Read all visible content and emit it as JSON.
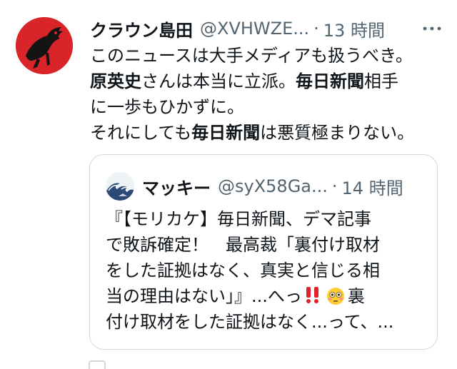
{
  "tweet": {
    "author_name": "クラウン島田",
    "author_handle": "@XVHWZE...",
    "separator": "·",
    "time": "13 時間",
    "lines": {
      "l1": "このニュースは大手メディアも扱うべき。",
      "l2_b1": "原英史",
      "l2_t1": "さんは本当に立派。",
      "l2_b2": "毎日新聞",
      "l2_t2": "相手",
      "l3": "に一歩もひかずに。",
      "l4_t1": "それにしても",
      "l4_b1": "毎日新聞",
      "l4_t2": "は悪質極まりない。"
    }
  },
  "quote": {
    "author_name": "マッキー",
    "author_handle": "@syX58Ga...",
    "separator": "·",
    "time": "14 時間",
    "lines": {
      "l1": "『【モリカケ】毎日新聞、デマ記事",
      "l2": "で敗訴確定！　最高裁「裏付け取材",
      "l3": "をした証拠はなく、真実と信じる相",
      "l4_a": "当の理由はない」』...へっ",
      "l4_b": "裏",
      "l5": "付け取材をした証拠はなく...って、..."
    }
  },
  "icons": {
    "more": "more-horizontal-icon",
    "double_exclamation": "double-exclamation-emoji",
    "flushed": "flushed-face-emoji"
  },
  "colors": {
    "secondary_text": "#536471",
    "border": "#cfd9de",
    "avatar_red": "#d9252a",
    "exclamation_red": "#e0202a"
  }
}
